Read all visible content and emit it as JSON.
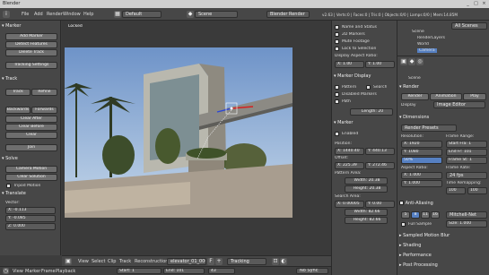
{
  "window": {
    "title": "Blender",
    "controls": [
      "_",
      "□",
      "×"
    ]
  },
  "menubar": {
    "items": [
      "File",
      "Add",
      "Render",
      "Window",
      "Help"
    ],
    "layout": "Default",
    "scene": "Scene",
    "engine": "Blender Render",
    "stats": "v2.63 | Verts:0 | Faces:0 | Tris:0 | Objects:0/0 | Lamps:0/0 | Mem:14.85M"
  },
  "left_panel": {
    "marker": {
      "title": "Marker",
      "buttons": [
        "Add Marker",
        "Detect Features",
        "Delete Track"
      ]
    },
    "tracking_settings": "Tracking Settings",
    "track": {
      "title": "Track",
      "buttons": [
        "Track",
        "Refine",
        "Backwards",
        "Forwards",
        "Clear After",
        "Clear Before",
        "Clear",
        "Join"
      ]
    },
    "solve": {
      "title": "Solve",
      "buttons": [
        "Camera Motion",
        "Clear Solution"
      ],
      "tripod_label": "Tripod Motion"
    },
    "translate": {
      "title": "Translate",
      "vector_label": "Vector:",
      "fields": [
        "X: -0.113",
        "Y: -0.085",
        "Z: 0.000"
      ]
    }
  },
  "viewport": {
    "locked_label": "Locked"
  },
  "toolbar": {
    "items": [
      "View",
      "Select",
      "Clip",
      "Track",
      "Reconstruction"
    ],
    "clip_name": "elevator_01_0001",
    "mode": "Tracking"
  },
  "timeline": {
    "items": [
      "View",
      "Marker",
      "Frame",
      "Playback"
    ],
    "start": "Start: 1",
    "end": "End: 101",
    "current": "43",
    "sync": "No Sync",
    "ticks": [
      "-40",
      "-20",
      "0",
      "20",
      "40",
      "60",
      "80",
      "100",
      "120",
      "140",
      "160",
      "180",
      "200",
      "220",
      "240",
      "260"
    ]
  },
  "prop_strip": {
    "options": [
      "Name and Status",
      "2D Markers",
      "Mute Footage",
      "Lock to Selection"
    ],
    "display_aspect_label": "Display Aspect Ratio:",
    "aspect_x": "X: 1.00",
    "aspect_y": "Y: 1.00",
    "marker_display": {
      "title": "Marker Display",
      "pattern": "Pattern",
      "search": "Search",
      "path": "Path",
      "disabled_markers": "Disabled Markers",
      "path_length": "Length: 20"
    },
    "marker": {
      "title": "Marker",
      "enabled": "Enabled",
      "position_label": "Position:",
      "pos_x": "X: 1440.40",
      "pos_y": "Y: 440.13",
      "offset_label": "Offset:",
      "off_x": "X: 225.39",
      "off_y": "Y: 272.46",
      "pattern_label": "Pattern Area:",
      "pat_w": "Width: 20.38",
      "pat_h": "Height: 20.38",
      "search_label": "Search Area:",
      "search_x": "X: 0.00005",
      "search_y": "Y: 0.00",
      "search_w": "Width: 82.66",
      "search_h": "Height: 82.66"
    }
  },
  "outliner": {
    "header": "All Scenes",
    "items": [
      "Scene",
      "RenderLayers",
      "World",
      "Camera"
    ]
  },
  "properties": {
    "scene_label": "Scene",
    "render": {
      "title": "Render",
      "buttons": [
        "Render",
        "Animation",
        "Play"
      ],
      "display_label": "Display",
      "display_value": "Image Editor"
    },
    "dimensions": {
      "title": "Dimensions",
      "preset": "Render Presets",
      "resolution_label": "Resolution:",
      "res_x": "X: 1920",
      "res_y": "Y: 1080",
      "res_pct": "50%",
      "frame_range_label": "Frame Range:",
      "start": "Start Fra: 1",
      "end": "End Fr: 101",
      "step": "Frame St: 1",
      "aspect_label": "Aspect Ratio:",
      "asp_x": "X: 1.000",
      "asp_y": "Y: 1.000",
      "fps_label": "Frame Rate:",
      "fps": "24 fps",
      "remap_label": "Time Remapping:",
      "remap_old": "100",
      "remap_new": "100"
    },
    "anti_aliasing": {
      "title": "Anti-Aliasing",
      "samples": [
        "5",
        "8",
        "11",
        "16"
      ],
      "filter": "Mitchell-Net",
      "full_sample": "Full Sample",
      "size": "Size: 1.000"
    },
    "collapsed": [
      "Sampled Motion Blur",
      "Shading",
      "Performance",
      "Post Processing"
    ]
  },
  "colors": {
    "accent": "#5680c2",
    "panel": "#474747",
    "field": "#5b5b5b",
    "button": "#6e6e6e",
    "active": "#f0a35a"
  }
}
